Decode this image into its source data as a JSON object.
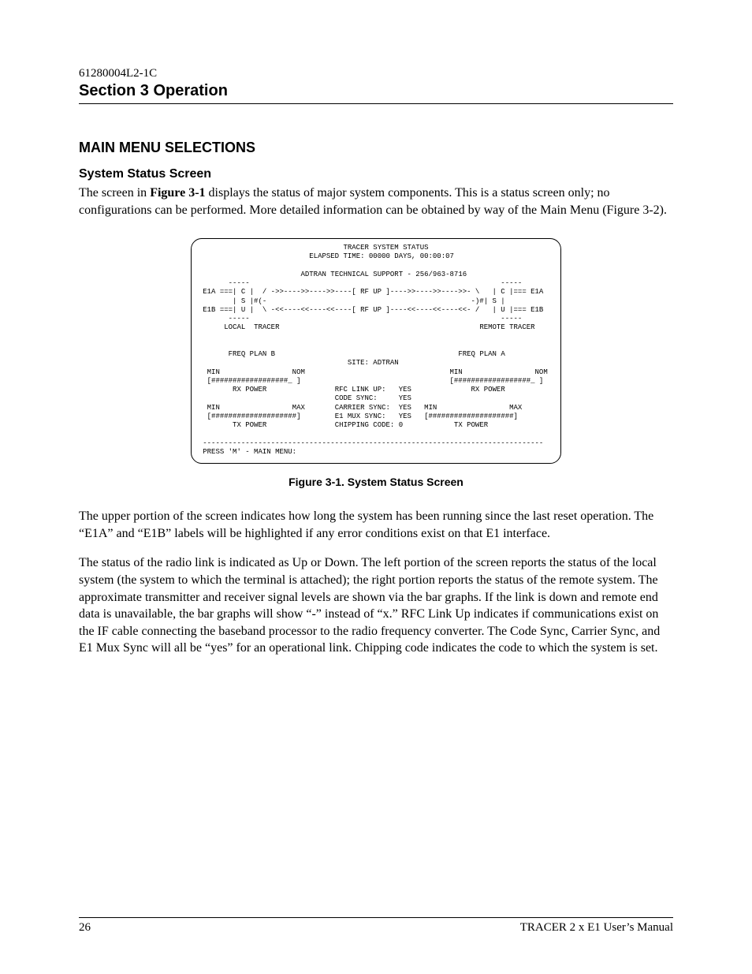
{
  "header": {
    "doc_code": "61280004L2-1C",
    "section_title": "Section 3  Operation"
  },
  "headings": {
    "main": "MAIN MENU SELECTIONS",
    "sub": "System Status Screen"
  },
  "paragraphs": {
    "p1_a": "The screen in ",
    "p1_bold": "Figure 3-1",
    "p1_b": " displays the status of major system components.  This is a status screen only; no configurations can be performed.  More detailed information can be obtained by way of the Main Menu (Figure 3-2).",
    "p2": "The upper portion of the screen indicates how long the system has been running since the last reset operation.  The “E1A” and “E1B” labels will be highlighted if any error conditions exist on that E1 interface.",
    "p3": "The status of the radio link is indicated as Up or Down.  The left portion of the screen reports the status of the local system (the system to which the terminal is attached); the right portion reports the status of the remote system.  The approximate transmitter and receiver signal levels are shown via the bar graphs.  If the link is down and remote end data is unavailable, the bar graphs will show “-”  instead of “x.”   RFC Link Up indicates if communications exist on the IF cable connecting the baseband processor to the radio frequency converter.  The Code Sync, Carrier Sync, and E1 Mux Sync will all be “yes” for an operational link.  Chipping code indicates the code to which the system is set."
  },
  "terminal": {
    "title": "TRACER SYSTEM STATUS",
    "elapsed": "ELAPSED TIME: 00000 DAYS, 00:00:07",
    "support": "ADTRAN TECHNICAL SUPPORT - 256/963-8716",
    "local_label": "LOCAL  TRACER",
    "remote_label": "REMOTE TRACER",
    "freq_plan_local": "FREQ PLAN B",
    "freq_plan_remote": "FREQ PLAN A",
    "site": "SITE: ADTRAN",
    "rfc_link_up": "RFC LINK UP:   YES",
    "code_sync": "CODE SYNC:     YES",
    "carrier_sync": "CARRIER SYNC:  YES",
    "e1_mux_sync": "E1 MUX SYNC:   YES",
    "chipping": "CHIPPING CODE: 0",
    "press_m": "PRESS 'M' - MAIN MENU:"
  },
  "figure": {
    "caption": "Figure 3-1.  System Status Screen"
  },
  "footer": {
    "page_number": "26",
    "right": "TRACER 2 x E1 User’s Manual"
  }
}
